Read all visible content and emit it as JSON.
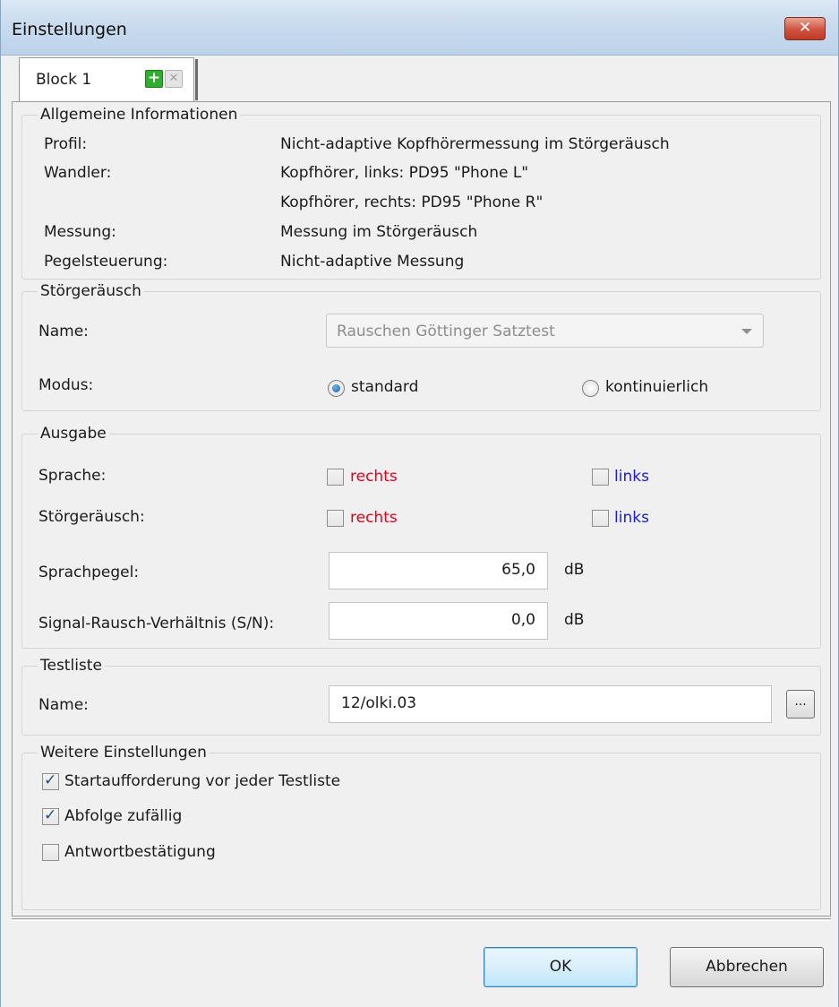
{
  "window": {
    "title": "Einstellungen",
    "close_label": "✕"
  },
  "tabs": [
    {
      "label": "Block 1",
      "add_label": "+",
      "remove_label": "✕"
    }
  ],
  "general": {
    "title": "Allgemeine Informationen",
    "profil_label": "Profil:",
    "profil_value": "Nicht-adaptive Kopfhörermessung im Störgeräusch",
    "wandler_label": "Wandler:",
    "wandler_value_1": "Kopfhörer, links: PD95 \"Phone L\"",
    "wandler_value_2": "Kopfhörer, rechts: PD95 \"Phone R\"",
    "messung_label": "Messung:",
    "messung_value": "Messung im Störgeräusch",
    "pegel_label": "Pegelsteuerung:",
    "pegel_value": "Nicht-adaptive Messung"
  },
  "noise": {
    "title": "Störgeräusch",
    "name_label": "Name:",
    "name_value": "Rauschen Göttinger Satztest",
    "modus_label": "Modus:",
    "mode_standard": "standard",
    "mode_continuous": "kontinuierlich",
    "selected_mode": "standard"
  },
  "output": {
    "title": "Ausgabe",
    "sprache_label": "Sprache:",
    "stoer_label": "Störgeräusch:",
    "rechts": "rechts",
    "links": "links",
    "sprachpegel_label": "Sprachpegel:",
    "sprachpegel_value": "65,0",
    "snr_label": "Signal-Rausch-Verhältnis (S/N):",
    "snr_value": "0,0",
    "unit": "dB",
    "sprache_rechts": false,
    "sprache_links": false,
    "stoer_rechts": false,
    "stoer_links": false,
    "color_right": "#e3001b",
    "color_left": "#1a1ad8"
  },
  "testlist": {
    "title": "Testliste",
    "name_label": "Name:",
    "name_value": "12/olki.03",
    "browse_label": "..."
  },
  "further": {
    "title": "Weitere Einstellungen",
    "options": [
      {
        "label": "Startaufforderung vor jeder Testliste",
        "checked": true
      },
      {
        "label": "Abfolge zufällig",
        "checked": true
      },
      {
        "label": "Antwortbestätigung",
        "checked": false
      }
    ]
  },
  "buttons": {
    "ok": "OK",
    "cancel": "Abbrechen"
  }
}
